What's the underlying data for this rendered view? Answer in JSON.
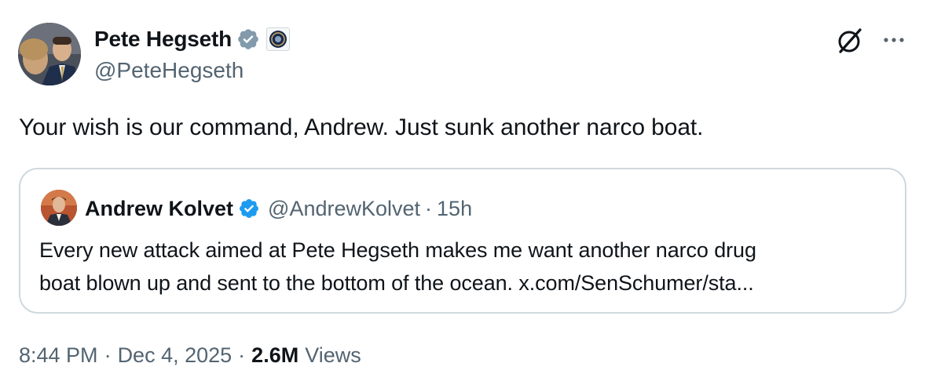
{
  "tweet": {
    "author_name": "Pete Hegseth",
    "author_handle": "@PeteHegseth",
    "verified_icon": "verified-badge-icon",
    "affiliation_icon": "department-seal-icon",
    "text": "Your wish is our command, Andrew. Just sunk another narco boat.",
    "time": "8:44 PM",
    "separator": "·",
    "date": "Dec 4, 2025",
    "views_count": "2.6M",
    "views_label": "Views"
  },
  "quote": {
    "author_name": "Andrew Kolvet",
    "author_handle": "@AndrewKolvet",
    "separator": "·",
    "time": "15h",
    "line1": "Every new attack aimed at Pete Hegseth makes me want another narco drug",
    "line2": "boat blown up and sent to the bottom of the ocean. x.com/SenSchumer/sta..."
  },
  "colors": {
    "verified_blue": "#1d9bf0",
    "text_primary": "#0f1419",
    "text_secondary": "#536471",
    "border": "#cfd9de"
  }
}
